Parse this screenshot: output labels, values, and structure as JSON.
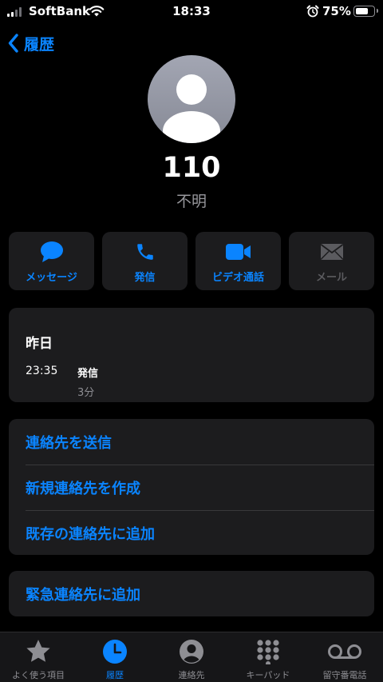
{
  "status_bar": {
    "carrier": "SoftBank",
    "time": "18:33",
    "battery": "75%",
    "battery_level": 0.75
  },
  "nav": {
    "back_label": "履歴"
  },
  "contact": {
    "number": "110",
    "subtitle": "不明"
  },
  "actions": [
    {
      "label": "メッセージ",
      "icon": "message-icon",
      "enabled": true
    },
    {
      "label": "発信",
      "icon": "phone-icon",
      "enabled": true
    },
    {
      "label": "ビデオ通話",
      "icon": "video-icon",
      "enabled": true
    },
    {
      "label": "メール",
      "icon": "mail-icon",
      "enabled": false
    }
  ],
  "history": {
    "date": "昨日",
    "time": "23:35",
    "type": "発信",
    "duration": "3分"
  },
  "options": {
    "send_contact": "連絡先を送信",
    "create_contact": "新規連絡先を作成",
    "add_existing": "既存の連絡先に追加",
    "add_emergency": "緊急連絡先に追加"
  },
  "tabs": [
    {
      "label": "よく使う項目",
      "icon": "star-icon",
      "active": false
    },
    {
      "label": "履歴",
      "icon": "clock-icon",
      "active": true
    },
    {
      "label": "連絡先",
      "icon": "person-icon",
      "active": false
    },
    {
      "label": "キーパッド",
      "icon": "keypad-icon",
      "active": false
    },
    {
      "label": "留守番電話",
      "icon": "voicemail-icon",
      "active": false
    }
  ],
  "colors": {
    "accent": "#0a84ff",
    "background": "#000000",
    "card": "#1c1c1e",
    "secondary_text": "#8e8e93"
  }
}
